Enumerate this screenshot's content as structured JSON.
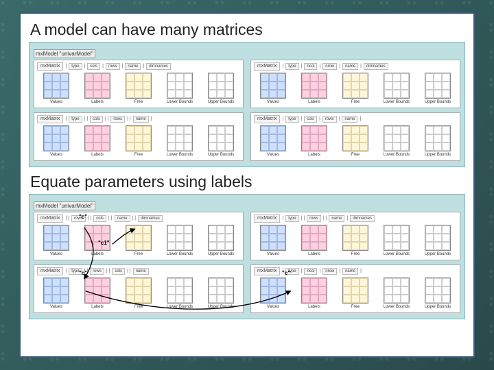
{
  "heading1": "A model can have many matrices",
  "heading2": "Equate parameters using labels",
  "modelHeader": "mxModel \"univarModel\"",
  "matrixHeader": "mxMatrix",
  "headerCols": [
    "type",
    "cols",
    "rows",
    "name",
    "dimnames"
  ],
  "headerColsB": [
    "type",
    "ncol",
    "nrow",
    "name",
    "dimnames"
  ],
  "cells": {
    "values": "Values",
    "labels": "Labels",
    "free": "Free",
    "lbound": "Lower\nBounds",
    "ubound": "Upper\nBounds"
  },
  "anno_c": "\"c\"",
  "anno_c1": "\"c1\""
}
